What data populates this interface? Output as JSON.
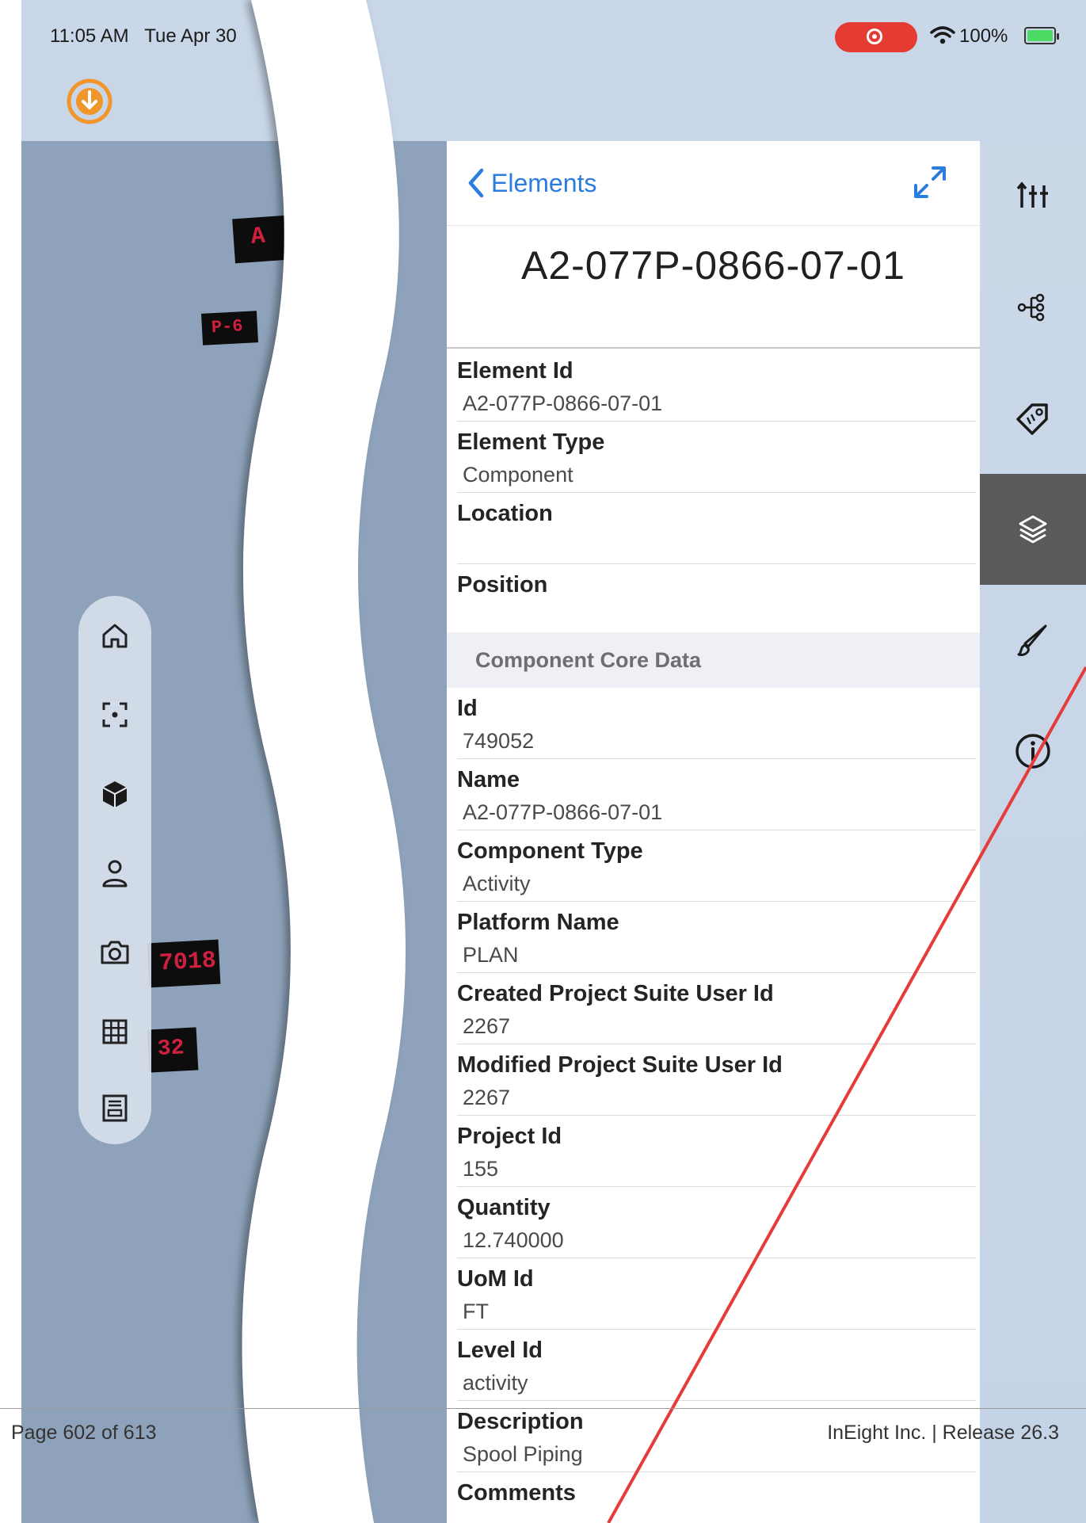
{
  "status_bar": {
    "time": "11:05 AM",
    "date": "Tue Apr 30",
    "battery": "100%"
  },
  "panel": {
    "back_label": "Elements",
    "title": "A2-077P-0866-07-01",
    "fields_top": [
      {
        "label": "Element Id",
        "value": "A2-077P-0866-07-01"
      },
      {
        "label": "Element Type",
        "value": "Component"
      },
      {
        "label": "Location",
        "value": ""
      },
      {
        "label": "Position",
        "value": ""
      }
    ],
    "section_title": "Component Core Data",
    "fields_core": [
      {
        "label": "Id",
        "value": "749052"
      },
      {
        "label": "Name",
        "value": "A2-077P-0866-07-01"
      },
      {
        "label": "Component Type",
        "value": "Activity"
      },
      {
        "label": "Platform Name",
        "value": "PLAN"
      },
      {
        "label": "Created Project Suite User Id",
        "value": "2267"
      },
      {
        "label": "Modified Project Suite User Id",
        "value": "2267"
      },
      {
        "label": "Project Id",
        "value": "155"
      },
      {
        "label": "Quantity",
        "value": "12.740000"
      },
      {
        "label": "UoM Id",
        "value": "FT"
      },
      {
        "label": "Level Id",
        "value": "activity"
      },
      {
        "label": "Description",
        "value": "Spool Piping"
      },
      {
        "label": "Comments",
        "value": ""
      }
    ]
  },
  "viewport_tags": [
    "A",
    "P-6",
    "7018",
    "32"
  ],
  "side_toolbar_icons": [
    "home-icon",
    "focus-icon",
    "cube-icon",
    "person-icon",
    "camera-icon",
    "grid-icon",
    "sheet-icon"
  ],
  "right_rail_icons": [
    "filter-sliders-icon",
    "tree-icon",
    "tag-icon",
    "layers-icon",
    "brush-icon",
    "info-icon"
  ],
  "right_rail_active": "layers-icon",
  "accent_color": "#2a7ce0",
  "footer": {
    "page": "Page 602 of 613",
    "release": "InEight Inc.  |  Release 26.3"
  }
}
